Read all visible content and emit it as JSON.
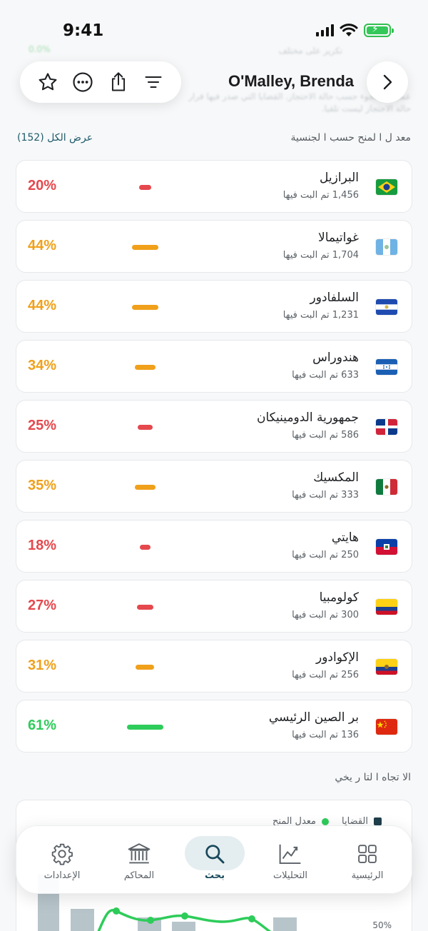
{
  "status_bar": {
    "time": "9:41"
  },
  "header": {
    "title": "O'Malley, Brenda"
  },
  "section": {
    "label": "معد ل ا لمنح حسب ا لجنسية",
    "view_all": "عرض الكل (152)"
  },
  "countries": [
    {
      "name": "البرازيل",
      "decided": "1,456 تم البت فيها",
      "rate": 20,
      "rate_label": "20%",
      "level": "low",
      "flag": "brazil-flag"
    },
    {
      "name": "غواتيمالا",
      "decided": "1,704 تم البت فيها",
      "rate": 44,
      "rate_label": "44%",
      "level": "mid",
      "flag": "guatemala-flag"
    },
    {
      "name": "السلفادور",
      "decided": "1,231 تم البت فيها",
      "rate": 44,
      "rate_label": "44%",
      "level": "mid",
      "flag": "el-salvador-flag"
    },
    {
      "name": "هندوراس",
      "decided": "633 تم البت فيها",
      "rate": 34,
      "rate_label": "34%",
      "level": "mid",
      "flag": "honduras-flag"
    },
    {
      "name": "جمهورية الدومينيكان",
      "decided": "586 تم البت فيها",
      "rate": 25,
      "rate_label": "25%",
      "level": "low",
      "flag": "dominican-republic-flag"
    },
    {
      "name": "المكسيك",
      "decided": "333 تم البت فيها",
      "rate": 35,
      "rate_label": "35%",
      "level": "mid",
      "flag": "mexico-flag"
    },
    {
      "name": "هايتي",
      "decided": "250 تم البت فيها",
      "rate": 18,
      "rate_label": "18%",
      "level": "low",
      "flag": "haiti-flag"
    },
    {
      "name": "كولومبيا",
      "decided": "300 تم البت فيها",
      "rate": 27,
      "rate_label": "27%",
      "level": "low",
      "flag": "colombia-flag"
    },
    {
      "name": "الإكوادور",
      "decided": "256 تم البت فيها",
      "rate": 31,
      "rate_label": "31%",
      "level": "mid",
      "flag": "ecuador-flag"
    },
    {
      "name": "بر الصين الرئيسي",
      "decided": "136 تم البت فيها",
      "rate": 61,
      "rate_label": "61%",
      "level": "high",
      "flag": "china-flag"
    }
  ],
  "colors": {
    "low": "#e5484d",
    "mid": "#f0a01a",
    "high": "#2ecc5a"
  },
  "trend": {
    "label": "الا تجاه ا لتا ر يخي",
    "legend": [
      "القضايا",
      "معدل المنح"
    ],
    "axis_tick": "50%"
  },
  "tabs": [
    {
      "label": "الإعدادات",
      "icon": "gear-icon"
    },
    {
      "label": "المحاكم",
      "icon": "courthouse-icon"
    },
    {
      "label": "بحث",
      "icon": "search-icon",
      "active": true
    },
    {
      "label": "التحليلات",
      "icon": "analytics-chart-icon"
    },
    {
      "label": "الرئيسية",
      "icon": "home-grid-icon"
    }
  ],
  "background_text": [
    "تكرير على مختلف",
    "عمليات اللجوء حسب حالة الاحتجاز. القضايا التي صدر فيها قرار",
    "حالة الاحتجاز ليست تلقيا."
  ]
}
